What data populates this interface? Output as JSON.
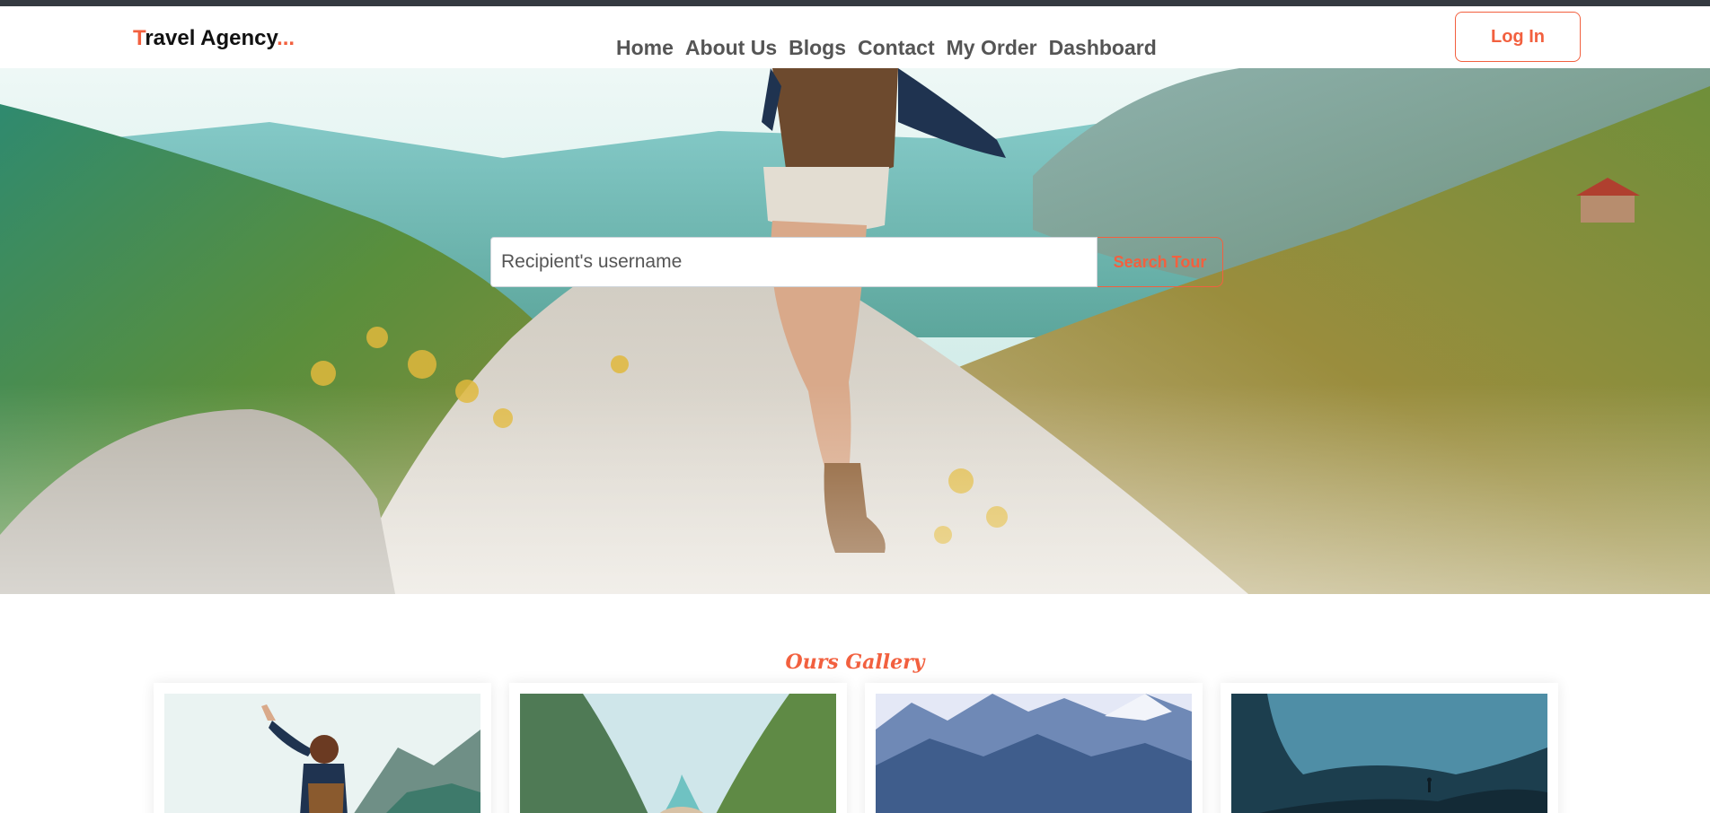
{
  "navbar": {
    "brand_first": "T",
    "brand_main": "ravel Agency",
    "brand_dots": "...",
    "links": [
      {
        "label": "Home"
      },
      {
        "label": "About Us"
      },
      {
        "label": "Blogs"
      },
      {
        "label": "Contact"
      },
      {
        "label": "My Order"
      },
      {
        "label": "Dashboard"
      }
    ],
    "login_label": "Log In"
  },
  "hero": {
    "search_placeholder": "Recipient's username",
    "search_button": "Search Tour"
  },
  "gallery": {
    "title": "Ours Gallery",
    "images": [
      {
        "icon": "hiker-arms-raised-image"
      },
      {
        "icon": "river-canyon-image"
      },
      {
        "icon": "blue-mountains-image"
      },
      {
        "icon": "cave-image"
      }
    ]
  },
  "colors": {
    "accent": "#f2603f",
    "navbar_strip": "#343a40",
    "nav_text": "#555555"
  }
}
